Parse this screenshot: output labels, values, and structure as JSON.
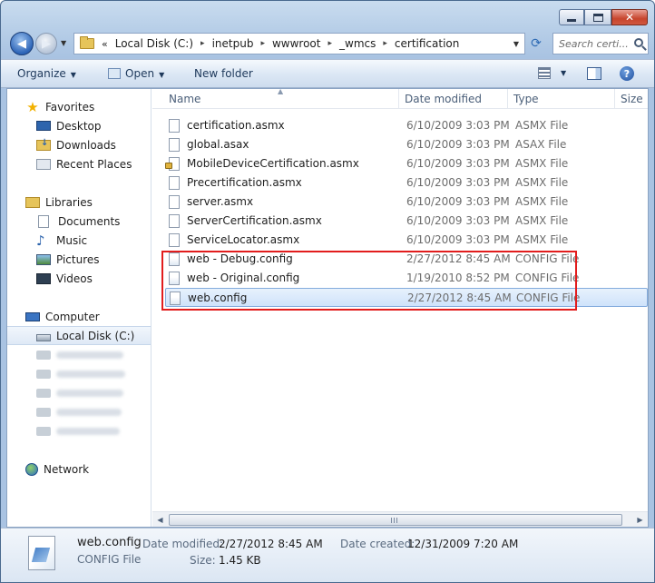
{
  "address": {
    "overflow": "«",
    "crumbs": [
      "Local Disk (C:)",
      "inetpub",
      "wwwroot",
      "_wmcs",
      "certification"
    ],
    "search_placeholder": "Search certi..."
  },
  "toolbar": {
    "organize": "Organize",
    "open": "Open",
    "new_folder": "New folder"
  },
  "nav": {
    "favorites": {
      "label": "Favorites",
      "items": [
        "Desktop",
        "Downloads",
        "Recent Places"
      ]
    },
    "libraries": {
      "label": "Libraries",
      "items": [
        "Documents",
        "Music",
        "Pictures",
        "Videos"
      ]
    },
    "computer": {
      "label": "Computer",
      "selected": "Local Disk (C:)"
    },
    "network": "Network"
  },
  "columns": {
    "name": "Name",
    "date": "Date modified",
    "type": "Type",
    "size": "Size"
  },
  "files": [
    {
      "name": "certification.asmx",
      "date": "6/10/2009 3:03 PM",
      "type": "ASMX File"
    },
    {
      "name": "global.asax",
      "date": "6/10/2009 3:03 PM",
      "type": "ASAX File"
    },
    {
      "name": "MobileDeviceCertification.asmx",
      "date": "6/10/2009 3:03 PM",
      "type": "ASMX File"
    },
    {
      "name": "Precertification.asmx",
      "date": "6/10/2009 3:03 PM",
      "type": "ASMX File"
    },
    {
      "name": "server.asmx",
      "date": "6/10/2009 3:03 PM",
      "type": "ASMX File"
    },
    {
      "name": "ServerCertification.asmx",
      "date": "6/10/2009 3:03 PM",
      "type": "ASMX File"
    },
    {
      "name": "ServiceLocator.asmx",
      "date": "6/10/2009 3:03 PM",
      "type": "ASMX File"
    },
    {
      "name": "web - Debug.config",
      "date": "2/27/2012 8:45 AM",
      "type": "CONFIG File"
    },
    {
      "name": "web - Original.config",
      "date": "1/19/2010 8:52 PM",
      "type": "CONFIG File"
    },
    {
      "name": "web.config",
      "date": "2/27/2012 8:45 AM",
      "type": "CONFIG File"
    }
  ],
  "details": {
    "name": "web.config",
    "type": "CONFIG File",
    "date_modified_label": "Date modified:",
    "date_modified": "2/27/2012 8:45 AM",
    "date_created_label": "Date created:",
    "date_created": "12/31/2009 7:20 AM",
    "size_label": "Size:",
    "size": "1.45 KB"
  },
  "colors": {
    "highlight": "#e21d1d",
    "selection": "#cfe3fb"
  }
}
